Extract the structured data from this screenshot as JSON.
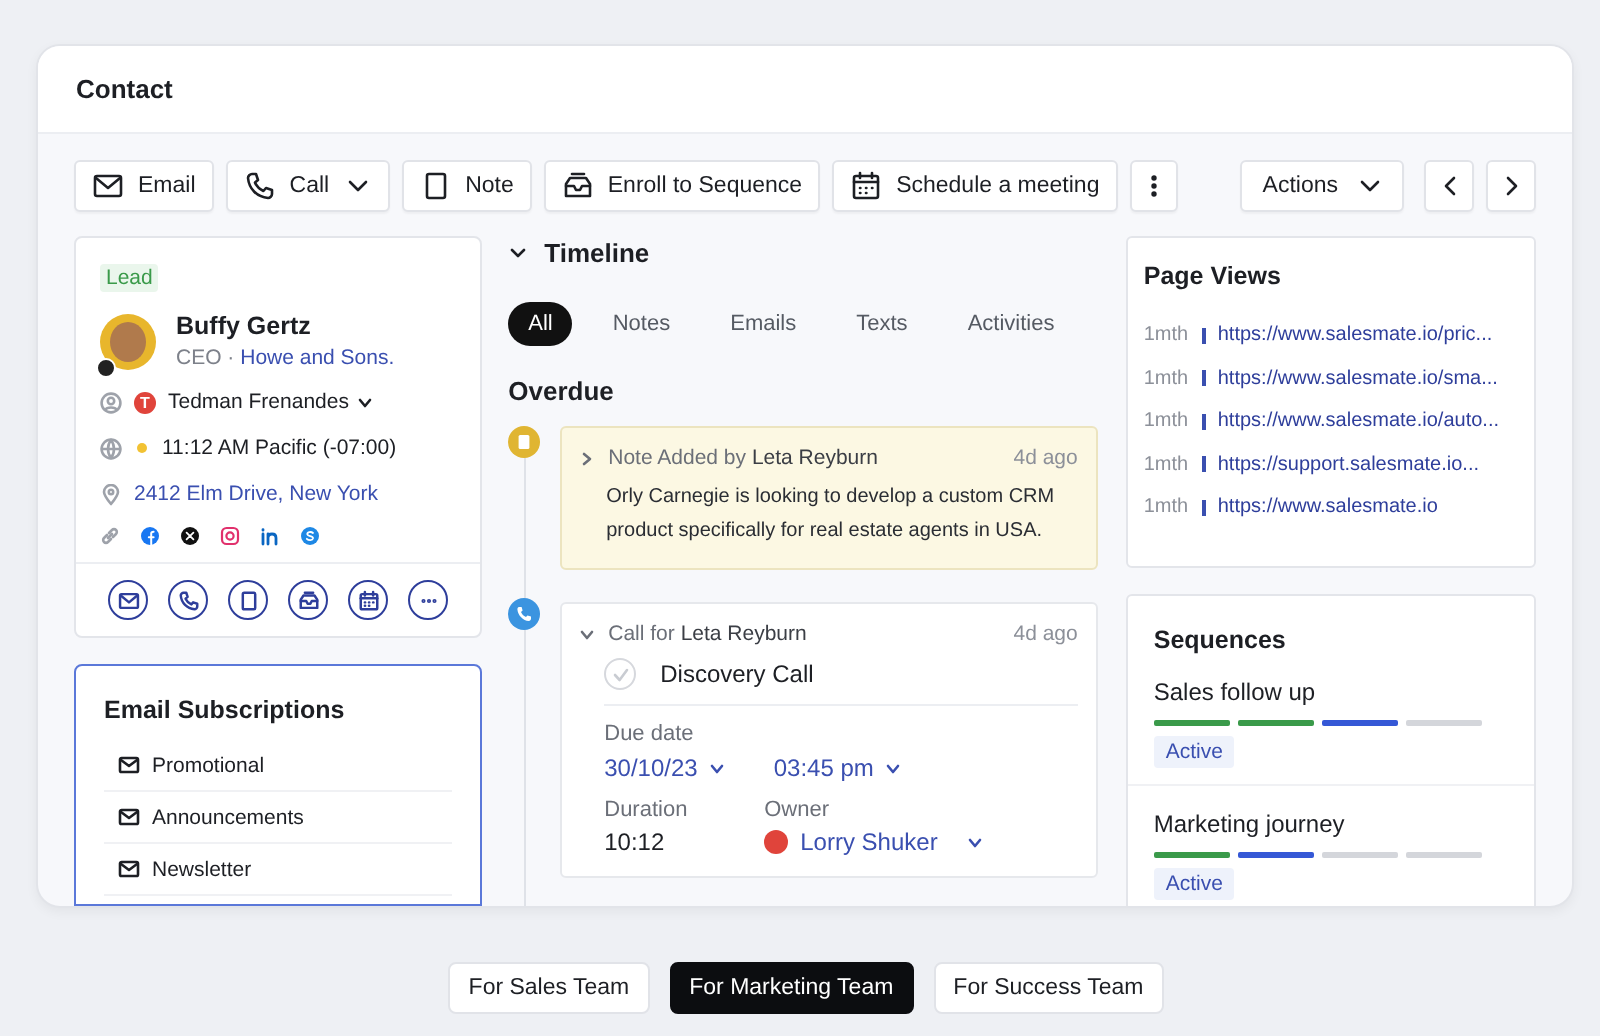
{
  "window": {
    "title": "Contact"
  },
  "toolbar": {
    "buttons": [
      {
        "label": "Email",
        "kind": "email",
        "dropdown": false
      },
      {
        "label": "Call",
        "kind": "call",
        "dropdown": true
      },
      {
        "label": "Note",
        "kind": "note",
        "dropdown": false
      },
      {
        "label": "Enroll to Sequence",
        "kind": "sequence",
        "dropdown": false
      },
      {
        "label": "Schedule a meeting",
        "kind": "meeting",
        "dropdown": false
      }
    ],
    "actions": "Actions"
  },
  "contact": {
    "status": "Lead",
    "name": "Buffy Gertz",
    "title": "CEO",
    "separator": "·",
    "company": "Howe and Sons.",
    "owner": {
      "initial": "T",
      "name": "Tedman Frenandes",
      "color": "#e0443b"
    },
    "local_time": "11:12 AM Pacific (-07:00)",
    "address": "2412 Elm Drive, New York",
    "socials": [
      {
        "kind": "facebook"
      },
      {
        "kind": "x"
      },
      {
        "kind": "instagram"
      },
      {
        "kind": "linkedin"
      },
      {
        "kind": "skype"
      }
    ],
    "quick_actions": [
      {
        "kind": "email"
      },
      {
        "kind": "call"
      },
      {
        "kind": "note"
      },
      {
        "kind": "sequence"
      },
      {
        "kind": "meeting"
      },
      {
        "kind": "more"
      }
    ]
  },
  "subscriptions": {
    "title": "Email Subscriptions",
    "items": [
      "Promotional",
      "Announcements",
      "Newsletter"
    ]
  },
  "timeline": {
    "title": "Timeline",
    "expanded": true,
    "tabs": [
      {
        "label": "All",
        "selected": true
      },
      {
        "label": "Notes",
        "selected": false
      },
      {
        "label": "Emails",
        "selected": false
      },
      {
        "label": "Texts",
        "selected": false
      },
      {
        "label": "Activities",
        "selected": false
      }
    ],
    "section": "Overdue",
    "items": [
      {
        "kind": "note",
        "expanded": false,
        "heading": "Note Added by **Leta Reyburn**",
        "time": "4d ago",
        "body": "Orly Carnegie is looking to develop a custom CRM product specifically for real estate agents in USA."
      },
      {
        "kind": "call",
        "expanded": true,
        "heading": "Call for **Leta Reyburn**",
        "time": "4d ago",
        "task": "Discovery Call",
        "done": false,
        "due_label": "Due date",
        "due_date": "30/10/23",
        "due_time": "03:45 pm",
        "duration_label": "Duration",
        "duration": "10:12",
        "owner_label": "Owner",
        "owner": {
          "name": "Lorry Shuker",
          "color": "#e0443b"
        }
      }
    ]
  },
  "page_views": {
    "title": "Page Views",
    "items": [
      {
        "age": "1mth",
        "url": "https://www.salesmate.io/pric..."
      },
      {
        "age": "1mth",
        "url": "https://www.salesmate.io/sma..."
      },
      {
        "age": "1mth",
        "url": "https://www.salesmate.io/auto..."
      },
      {
        "age": "1mth",
        "url": "https://support.salesmate.io..."
      },
      {
        "age": "1mth",
        "url": "https://www.salesmate.io"
      }
    ]
  },
  "sequences": {
    "title": "Sequences",
    "items": [
      {
        "name": "Sales follow up",
        "steps": [
          {
            "kind": "done"
          },
          {
            "kind": "done"
          },
          {
            "kind": "current"
          },
          {
            "kind": "pending"
          }
        ],
        "status": "Active"
      },
      {
        "name": "Marketing journey",
        "steps": [
          {
            "kind": "done"
          },
          {
            "kind": "current"
          },
          {
            "kind": "pending"
          },
          {
            "kind": "pending"
          }
        ],
        "status": "Active"
      }
    ]
  },
  "team_tabs": [
    {
      "label": "For Sales Team",
      "selected": false
    },
    {
      "label": "For Marketing Team",
      "selected": true
    },
    {
      "label": "For Success Team",
      "selected": false
    }
  ]
}
